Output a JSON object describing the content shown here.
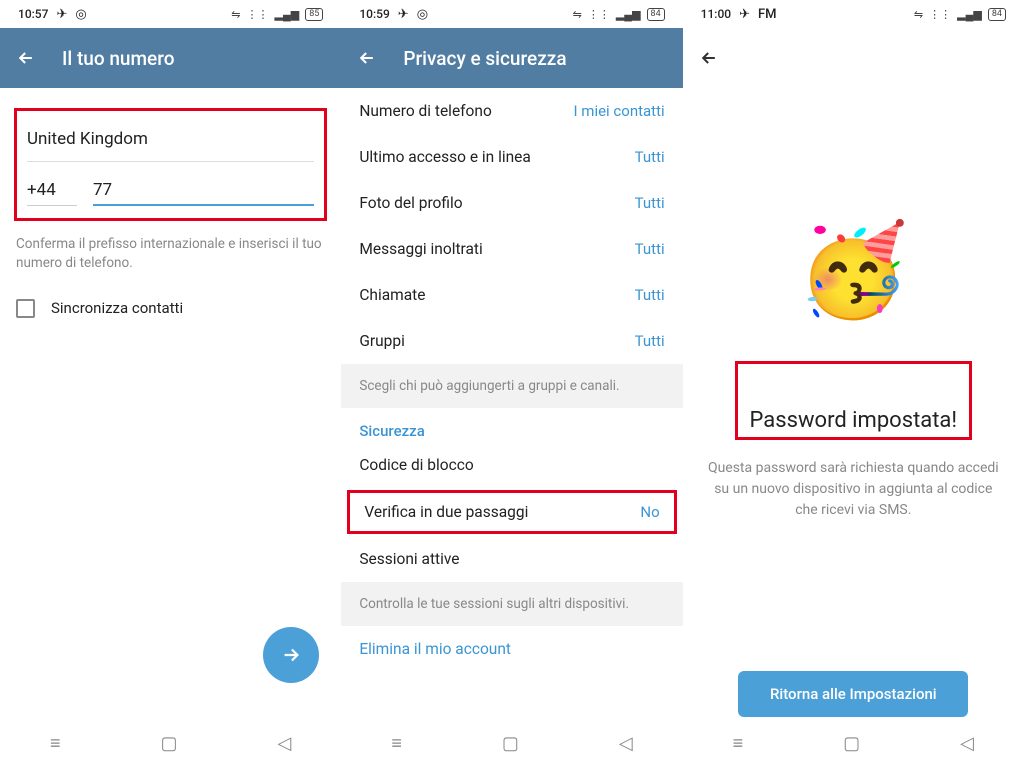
{
  "screen1": {
    "statusbar": {
      "time": "10:57",
      "battery": "85"
    },
    "appbar": {
      "title": "Il tuo numero"
    },
    "country": "United Kingdom",
    "prefix": "+44",
    "number": "77",
    "hint": "Conferma il prefisso internazionale e inserisci il tuo numero di telefono.",
    "sync": "Sincronizza contatti"
  },
  "screen2": {
    "statusbar": {
      "time": "10:59",
      "battery": "84"
    },
    "appbar": {
      "title": "Privacy e sicurezza"
    },
    "rows": {
      "numtel": {
        "label": "Numero di telefono",
        "val": "I miei contatti"
      },
      "lastseen": {
        "label": "Ultimo accesso e in linea",
        "val": "Tutti"
      },
      "photo": {
        "label": "Foto del profilo",
        "val": "Tutti"
      },
      "forward": {
        "label": "Messaggi inoltrati",
        "val": "Tutti"
      },
      "calls": {
        "label": "Chiamate",
        "val": "Tutti"
      },
      "groups": {
        "label": "Gruppi",
        "val": "Tutti"
      }
    },
    "hint1": "Scegli chi può aggiungerti a gruppi e canali.",
    "section": "Sicurezza",
    "lockcode": "Codice di blocco",
    "twostep": {
      "label": "Verifica in due passaggi",
      "val": "No"
    },
    "sessions": "Sessioni attive",
    "hint2": "Controlla le tue sessioni sugli altri dispositivi.",
    "delete": "Elimina il mio account"
  },
  "screen3": {
    "statusbar": {
      "time": "11:00",
      "radio": "FM",
      "battery": "84"
    },
    "title": "Password impostata!",
    "desc": "Questa password sarà richiesta quando accedi su un nuovo dispositivo in aggiunta al codice che ricevi via SMS.",
    "button": "Ritorna alle Impostazioni"
  }
}
